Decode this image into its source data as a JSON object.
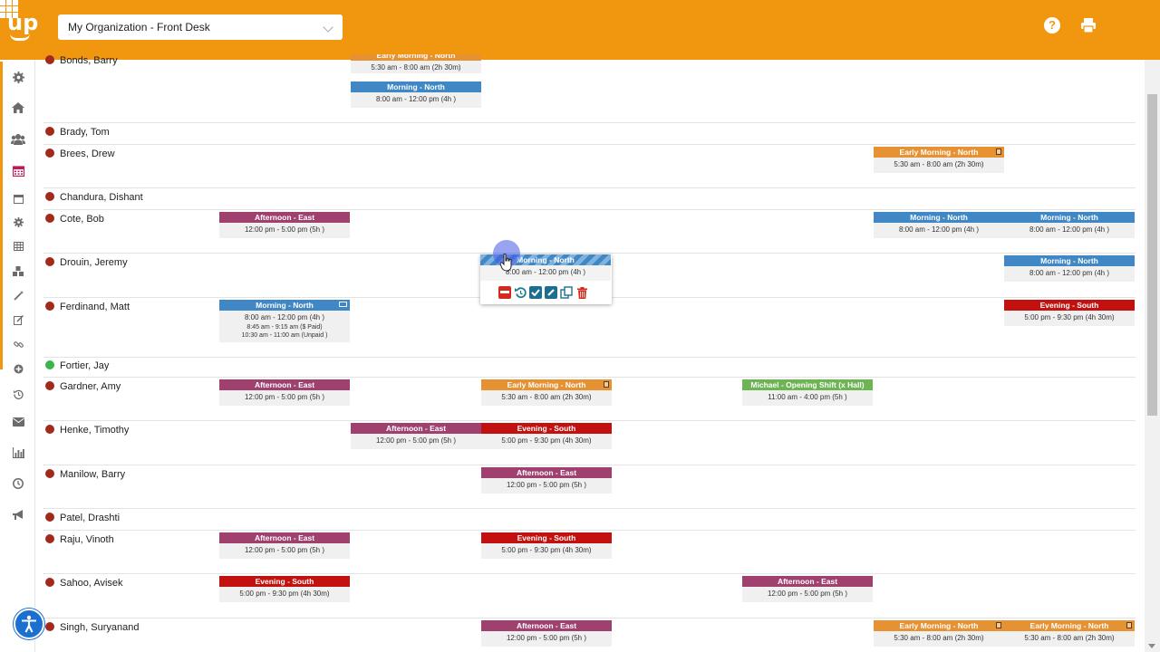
{
  "header": {
    "logo_text": "up",
    "organization_select": "My Organization - Front Desk",
    "icons": [
      "help-icon",
      "print-icon",
      "apps-grid-icon"
    ]
  },
  "sidebar": {
    "icons": [
      "gear-icon",
      "home-icon",
      "users-icon",
      "calendar-icon",
      "calendar-small-icon",
      "gear-small-icon",
      "table-icon",
      "cubes-icon",
      "magic-wand-icon",
      "edit-icon",
      "link-icon",
      "plus-circle-icon",
      "history-icon",
      "envelope-icon",
      "bar-chart-icon",
      "clock-icon",
      "megaphone-icon"
    ],
    "active": "calendar-icon"
  },
  "employees": [
    {
      "name": "Bonds, Barry",
      "status": "red"
    },
    {
      "name": "Brady, Tom",
      "status": "red"
    },
    {
      "name": "Brees, Drew",
      "status": "red"
    },
    {
      "name": "Chandura, Dishant",
      "status": "red"
    },
    {
      "name": "Cote, Bob",
      "status": "red"
    },
    {
      "name": "Drouin, Jeremy",
      "status": "red"
    },
    {
      "name": "Ferdinand, Matt",
      "status": "red"
    },
    {
      "name": "Fortier, Jay",
      "status": "green"
    },
    {
      "name": "Gardner, Amy",
      "status": "red"
    },
    {
      "name": "Henke, Timothy",
      "status": "red"
    },
    {
      "name": "Manilow, Barry",
      "status": "red"
    },
    {
      "name": "Patel, Drashti",
      "status": "red"
    },
    {
      "name": "Raju, Vinoth",
      "status": "red"
    },
    {
      "name": "Sahoo, Avisek",
      "status": "red"
    },
    {
      "name": "Singh, Suryanand",
      "status": "red"
    }
  ],
  "shifts": {
    "bonds_early": {
      "label": "Early Morning - North",
      "time": "5:30 am - 8:00 am (2h 30m)"
    },
    "bonds_morning": {
      "label": "Morning - North",
      "time": "8:00 am - 12:00 pm (4h )"
    },
    "brees_early": {
      "label": "Early Morning - North",
      "time": "5:30 am - 8:00 am (2h 30m)"
    },
    "cote_afternoon": {
      "label": "Afternoon - East",
      "time": "12:00 pm - 5:00 pm (5h )"
    },
    "cote_morning1": {
      "label": "Morning - North",
      "time": "8:00 am - 12:00 pm (4h )"
    },
    "cote_morning2": {
      "label": "Morning - North",
      "time": "8:00 am - 12:00 pm (4h )"
    },
    "drouin_morning": {
      "label": "Morning - North",
      "time": "8:00 am - 12:00 pm (4h )"
    },
    "ferdinand_morning": {
      "label": "Morning - North",
      "time": "8:00 am - 12:00 pm (4h )",
      "break1": "8:45 am - 9:15 am ($ Paid)",
      "break2": "10:30 am - 11:00 am (Unpaid )"
    },
    "ferdinand_evening": {
      "label": "Evening - South",
      "time": "5:00 pm - 9:30 pm (4h 30m)"
    },
    "gardner_afternoon": {
      "label": "Afternoon - East",
      "time": "12:00 pm - 5:00 pm (5h )"
    },
    "gardner_early": {
      "label": "Early Morning - North",
      "time": "5:30 am - 8:00 am (2h 30m)"
    },
    "gardner_opening": {
      "label": "Michael - Opening Shift (x Hall)",
      "time": "11:00 am - 4:00 pm (5h )"
    },
    "henke_afternoon": {
      "label": "Afternoon - East",
      "time": "12:00 pm - 5:00 pm (5h )"
    },
    "henke_evening": {
      "label": "Evening - South",
      "time": "5:00 pm - 9:30 pm (4h 30m)"
    },
    "manilow_afternoon": {
      "label": "Afternoon - East",
      "time": "12:00 pm - 5:00 pm (5h )"
    },
    "raju_afternoon": {
      "label": "Afternoon - East",
      "time": "12:00 pm - 5:00 pm (5h )"
    },
    "raju_evening": {
      "label": "Evening - South",
      "time": "5:00 pm - 9:30 pm (4h 30m)"
    },
    "sahoo_evening": {
      "label": "Evening - South",
      "time": "5:00 pm - 9:30 pm (4h 30m)"
    },
    "sahoo_afternoon": {
      "label": "Afternoon - East",
      "time": "12:00 pm - 5:00 pm (5h )"
    },
    "singh_afternoon": {
      "label": "Afternoon - East",
      "time": "12:00 pm - 5:00 pm (5h )"
    },
    "singh_early1": {
      "label": "Early Morning - North",
      "time": "5:30 am - 8:00 am (2h 30m)"
    },
    "singh_early2": {
      "label": "Early Morning - North",
      "time": "5:30 am - 8:00 am (2h 30m)"
    }
  },
  "popup": {
    "shift_label": "Morning - North",
    "shift_time": "8:00 am - 12:00 pm (4h )",
    "actions": [
      "unassign-icon",
      "undo-icon",
      "check-icon",
      "edit-icon",
      "copy-icon",
      "trash-icon"
    ]
  },
  "colors": {
    "brand_orange": "#f0960f",
    "afternoon_east": "#a0406f",
    "morning_north": "#3f87c5",
    "early_morning_north": "#e69132",
    "evening_south": "#c3110f",
    "opening_shift": "#6cb552",
    "status_inactive": "#a3291b",
    "status_active": "#3bb54a"
  }
}
